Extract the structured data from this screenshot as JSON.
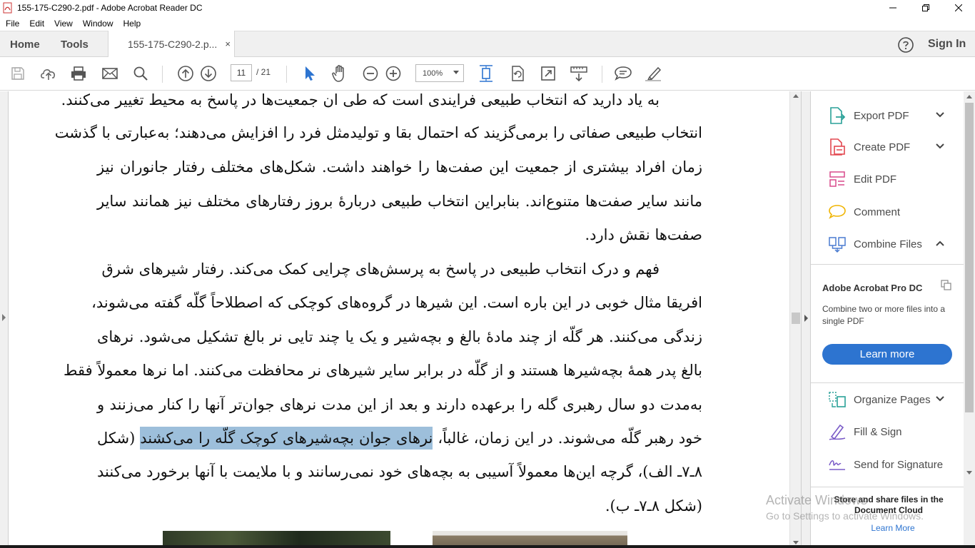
{
  "window": {
    "title": "155-175-C290-2.pdf - Adobe Acrobat Reader DC"
  },
  "menu": [
    "File",
    "Edit",
    "View",
    "Window",
    "Help"
  ],
  "tabs": {
    "home": "Home",
    "tools": "Tools",
    "document": "155-175-C290-2.p...",
    "close": "×",
    "sign_in": "Sign In"
  },
  "toolbar": {
    "page_current": "11",
    "page_total": "/ 21",
    "zoom": "100%",
    "icons": [
      "save-icon",
      "cloud-upload-icon",
      "print-icon",
      "email-icon",
      "search-icon",
      "page-up-icon",
      "page-down-icon",
      "select-cursor-icon",
      "hand-icon",
      "zoom-out-icon",
      "zoom-in-icon",
      "fit-page-icon",
      "rotate-icon",
      "fullscreen-icon",
      "scroll-mode-icon",
      "comment-icon",
      "highlight-pen-icon"
    ]
  },
  "document": {
    "lines": [
      "به یاد دارید که انتخاب طبیعی فرایندی است که طی ان جمعیت‌ها در پاسخ به محیط تغییر می‌کنند.",
      "انتخاب طبیعی صفاتی را برمی‌گزیند که احتمال بقا و تولیدمثل فرد را افزایش می‌دهند؛ به‌عبارتی با گذشت",
      "زمان افراد بیشتری از جمعیت این صفت‌ها را خواهند داشت. شکل‌های مختلف رفتار جانوران نیز",
      "مانند سایر صفت‌ها متنوع‌اند. بنابراین انتخاب طبیعی دربارهٔ بروز رفتارهای مختلف نیز همانند سایر",
      "صفت‌ها نقش دارد.",
      "فهم و درک انتخاب طبیعی در پاسخ به پرسش‌های چرایی کمک می‌کند. رفتار شیرهای شرق",
      "افریقا مثال خوبی در این باره است. این شیرها در گروه‌های کوچکی که اصطلاحاً گلّه گفته می‌شوند،",
      "زندگی می‌کنند. هر گلّه از چند مادهٔ بالغ و بچه‌شیر و یک یا چند تایی نر بالغ تشکیل می‌شود. نرهای",
      "بالغ پدر همهٔ بچه‌شیرها هستند و از گلّه در برابر سایر شیرهای نر محافظت می‌کنند. اما نرها معمولاً فقط",
      "به‌مدت دو سال رهبری گله را برعهده دارند و بعد از این مدت نرهای جوان‌تر آنها را کنار می‌زنند و"
    ],
    "line11_before": "خود رهبر گلّه می‌شوند. در این زمان، غالباً، ",
    "line11_highlight": "نرهای جوان بچه‌شیرهای کوچک گلّه را می‌کشند",
    "line11_after": " (شکل",
    "line12": "۸ـ۷ـ الف)، گرچه این‌ها معمولاً آسیبی به بچه‌های خود نمی‌رسانند و با ملایمت با آنها برخورد می‌کنند",
    "line13": "(شکل ۸ـ۷ـ ب)."
  },
  "right_pane": {
    "tools": [
      {
        "label": "Export PDF",
        "icon": "export-pdf-icon",
        "chevron": "down"
      },
      {
        "label": "Create PDF",
        "icon": "create-pdf-icon",
        "chevron": "down"
      },
      {
        "label": "Edit PDF",
        "icon": "edit-pdf-icon",
        "chevron": ""
      },
      {
        "label": "Comment",
        "icon": "comment-icon",
        "chevron": ""
      },
      {
        "label": "Combine Files",
        "icon": "combine-files-icon",
        "chevron": "up"
      }
    ],
    "promo": {
      "title": "Adobe Acrobat Pro DC",
      "text": "Combine two or more files into a single PDF",
      "button": "Learn more"
    },
    "tools2": [
      {
        "label": "Organize Pages",
        "icon": "organize-pages-icon",
        "chevron": "down"
      },
      {
        "label": "Fill & Sign",
        "icon": "fill-sign-icon",
        "chevron": ""
      },
      {
        "label": "Send for Signature",
        "icon": "send-signature-icon",
        "chevron": ""
      }
    ],
    "store": {
      "title": "Store and share files in the Document Cloud",
      "link": "Learn More"
    }
  },
  "watermark": {
    "line1": "Activate Windows",
    "line2": "Go to Settings to activate Windows."
  },
  "colors": {
    "accent": "#2d74d0",
    "highlight": "#9dbfdb",
    "tool_icon_teal": "#2aa198",
    "tool_icon_red": "#e34850",
    "tool_icon_pink": "#d94a8c",
    "tool_icon_yellow": "#f0b400",
    "tool_icon_blue": "#4a7bd0",
    "tool_icon_purple": "#7a5bc8"
  }
}
